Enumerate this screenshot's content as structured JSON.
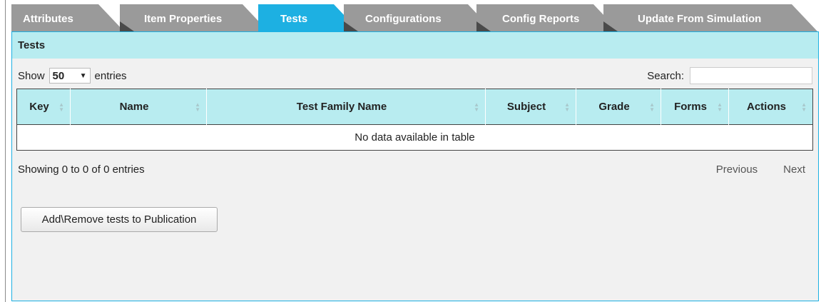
{
  "tabs": [
    {
      "label": "Attributes",
      "active": false
    },
    {
      "label": "Item Properties",
      "active": false
    },
    {
      "label": "Tests",
      "active": true
    },
    {
      "label": "Configurations",
      "active": false
    },
    {
      "label": "Config Reports",
      "active": false
    },
    {
      "label": "Update From Simulation",
      "active": false
    }
  ],
  "panel": {
    "title": "Tests",
    "show_label": "Show",
    "page_length": "50",
    "entries_label": "entries",
    "search_label": "Search:",
    "search_value": "",
    "columns": [
      "Key",
      "Name",
      "Test Family Name",
      "Subject",
      "Grade",
      "Forms",
      "Actions"
    ],
    "empty_message": "No data available in table",
    "info": "Showing 0 to 0 of 0 entries",
    "previous_label": "Previous",
    "next_label": "Next",
    "add_button_label": "Add\\Remove tests to Publication"
  },
  "colors": {
    "accent": "#1db0e2",
    "tab_inactive": "#9a9a9a",
    "header_bg": "#b8ecf0"
  },
  "icons": {
    "sort": "sort-both-icon",
    "dropdown": "chevron-down-icon"
  }
}
